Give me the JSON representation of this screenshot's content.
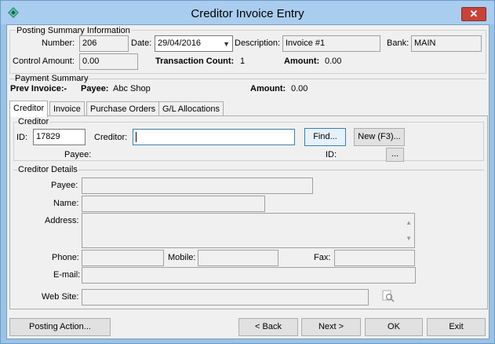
{
  "window": {
    "title": "Creditor Invoice Entry",
    "close_glyph": "✕"
  },
  "posting_summary": {
    "caption": "Posting Summary Information",
    "number_label": "Number:",
    "number_value": "206",
    "date_label": "Date:",
    "date_value": "29/04/2016",
    "description_label": "Description:",
    "description_value": "Invoice #1",
    "bank_label": "Bank:",
    "bank_value": "MAIN",
    "control_amount_label": "Control Amount:",
    "control_amount_value": "0.00",
    "transaction_count_label": "Transaction Count:",
    "transaction_count_value": "1",
    "amount_label": "Amount:",
    "amount_value": "0.00"
  },
  "payment_summary": {
    "caption": "Payment Summary",
    "prev_invoice_label": "Prev Invoice:-",
    "payee_label": "Payee:",
    "payee_value": "Abc Shop",
    "amount_label": "Amount:",
    "amount_value": "0.00"
  },
  "tabs": [
    {
      "label": "Creditor",
      "active": true
    },
    {
      "label": "Invoice",
      "active": false
    },
    {
      "label": "Purchase Orders",
      "active": false
    },
    {
      "label": "G/L Allocations",
      "active": false
    }
  ],
  "creditor": {
    "caption": "Creditor",
    "id_label": "ID:",
    "id_value": "17829",
    "creditor_label": "Creditor:",
    "creditor_value": "",
    "find_button": "Find...",
    "new_button": "New (F3)...",
    "payee_label": "Payee:",
    "id2_label": "ID:",
    "ellipsis_button": "..."
  },
  "creditor_details": {
    "caption": "Creditor Details",
    "payee_label": "Payee:",
    "payee_value": "",
    "name_label": "Name:",
    "name_value": "",
    "address_label": "Address:",
    "address_value": "",
    "phone_label": "Phone:",
    "phone_value": "",
    "mobile_label": "Mobile:",
    "mobile_value": "",
    "fax_label": "Fax:",
    "fax_value": "",
    "email_label": "E-mail:",
    "email_value": "",
    "website_label": "Web Site:",
    "website_value": ""
  },
  "footer": {
    "posting_action": "Posting Action...",
    "back": "< Back",
    "next": "Next >",
    "ok": "OK",
    "exit": "Exit"
  },
  "icons": {
    "app": "app-diamond-icon",
    "browse": "web-search-icon"
  }
}
